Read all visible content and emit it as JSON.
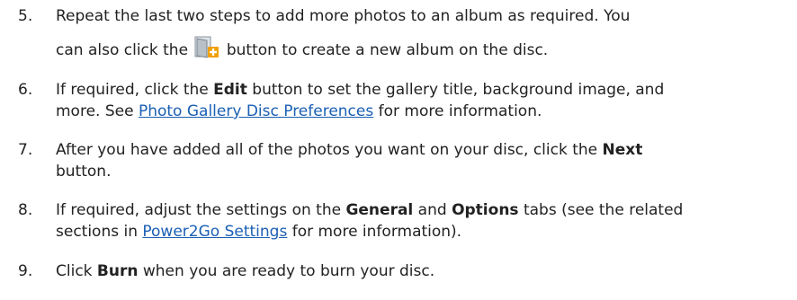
{
  "steps": [
    {
      "number": "5.",
      "line1": "Repeat the last two steps to add more photos to an album as required. You",
      "line2_before": "can also click the ",
      "icon": "new-album-icon",
      "line2_after": " button to create a new album on the disc."
    },
    {
      "number": "6.",
      "line1_pre": "If required, click the ",
      "line1_bold": "Edit",
      "line1_post": " button to set the gallery title, background image, and",
      "line2_pre": "more. See ",
      "line2_link": "Photo Gallery Disc Preferences",
      "line2_post": " for more information."
    },
    {
      "number": "7.",
      "line1_pre": "After you have added all of the photos you want on your disc, click the ",
      "line1_bold": "Next",
      "line2": "button."
    },
    {
      "number": "8.",
      "line1_pre": "If required, adjust the settings on the ",
      "line1_bold1": "General",
      "line1_mid": " and ",
      "line1_bold2": "Options",
      "line1_post": " tabs (see the related",
      "line2_pre": "sections in ",
      "line2_link": "Power2Go Settings",
      "line2_post": " for more information)."
    },
    {
      "number": "9.",
      "line1_pre": "Click ",
      "line1_bold": "Burn",
      "line1_post": " when you are ready to burn your disc."
    }
  ],
  "colors": {
    "text": "#222222",
    "link": "#1a5fb4",
    "icon_folder": "#9aa3ad",
    "icon_plus": "#f0a000"
  }
}
